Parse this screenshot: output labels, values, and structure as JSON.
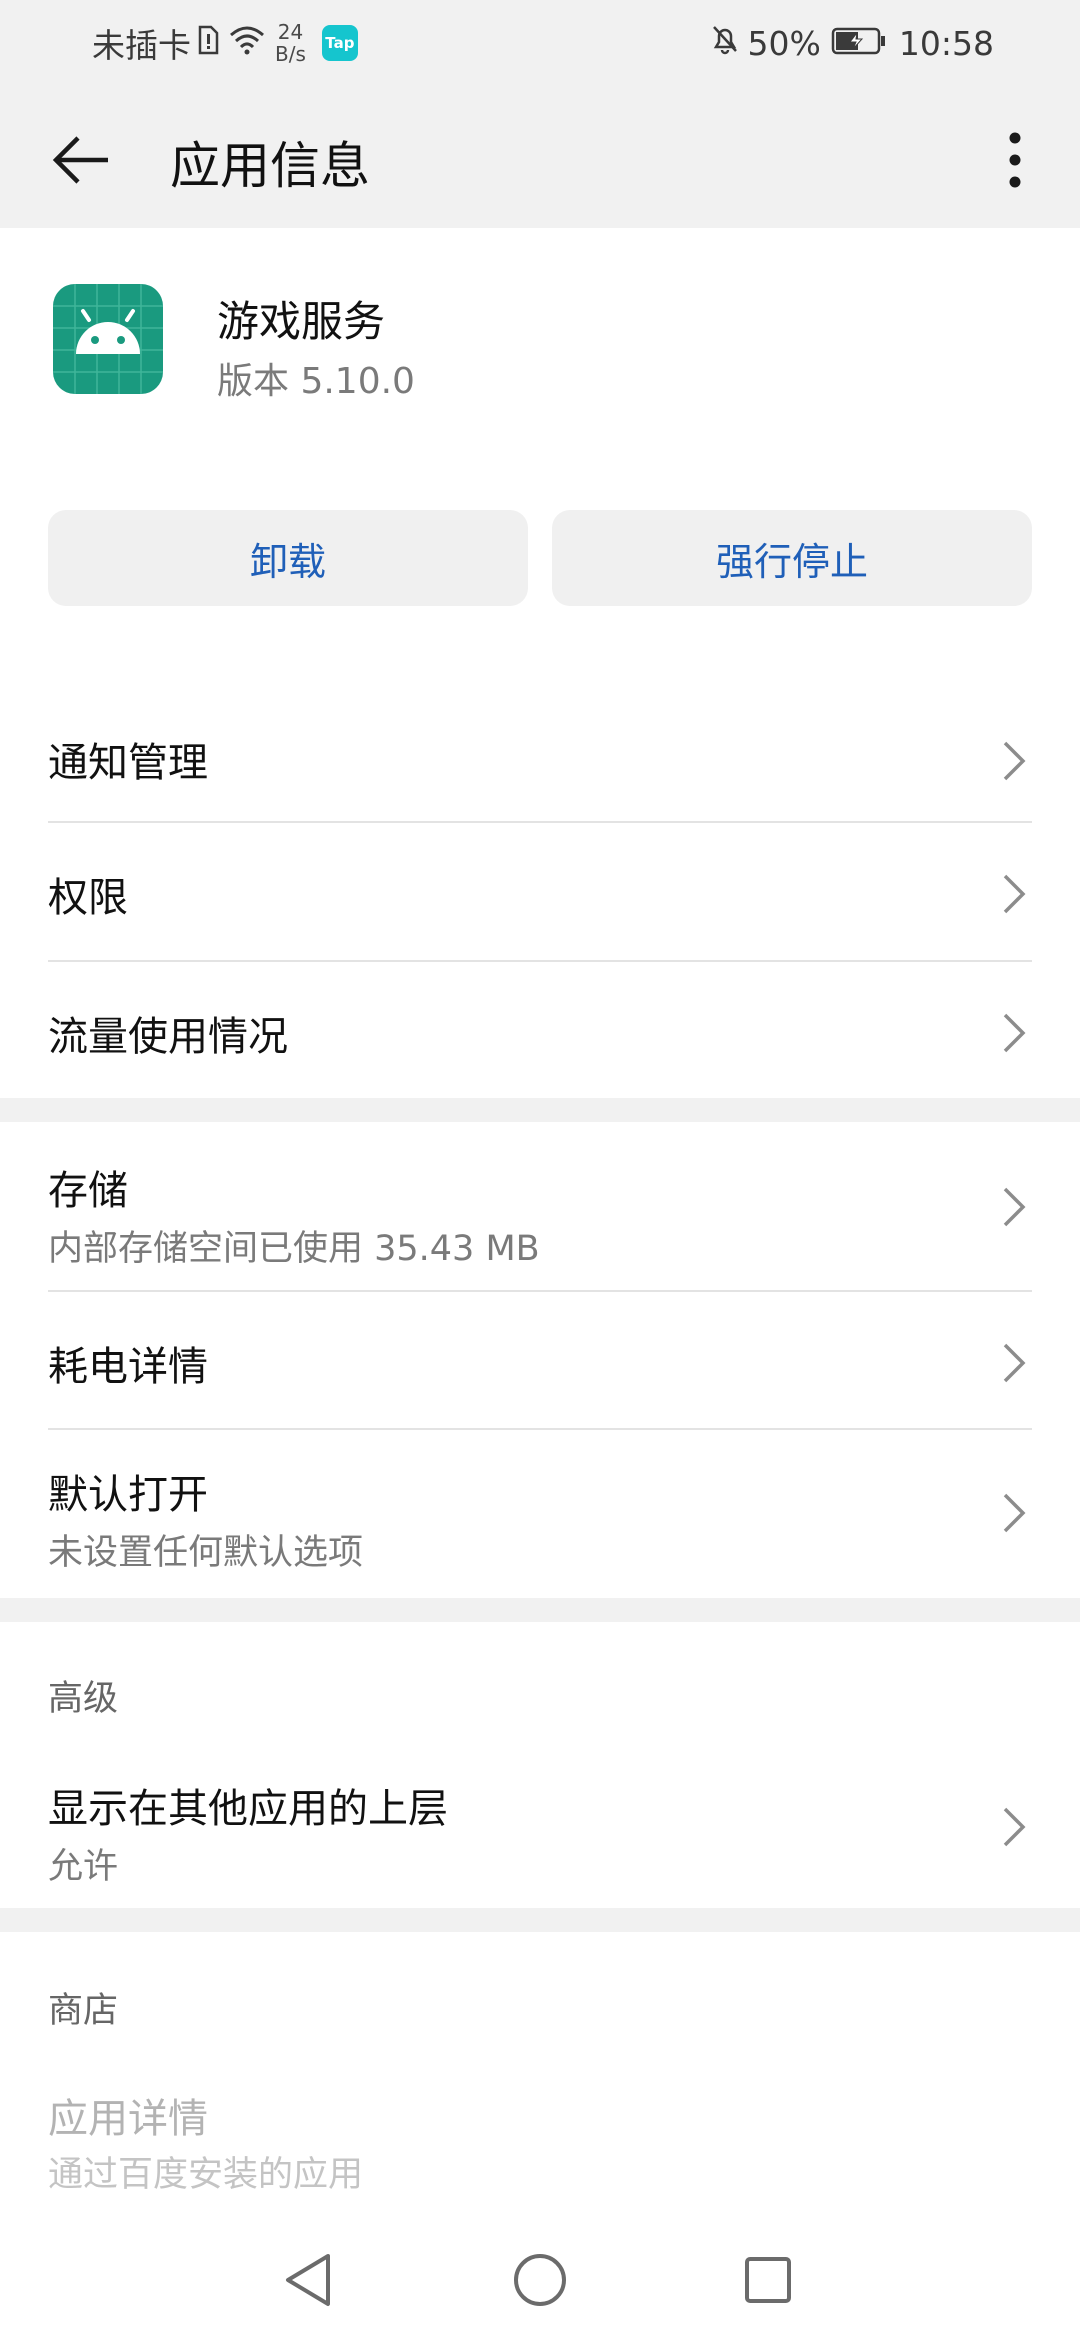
{
  "status_bar": {
    "carrier": "未插卡",
    "net_speed_value": "24",
    "net_speed_unit": "B/s",
    "tap_badge": "Tap",
    "battery_percent": "50%",
    "time": "10:58"
  },
  "app_bar": {
    "title": "应用信息"
  },
  "app": {
    "name": "游戏服务",
    "version": "版本 5.10.0",
    "icon_color": "#1a9a7f"
  },
  "actions": {
    "uninstall": "卸载",
    "force_stop": "强行停止",
    "accent": "#1f5fb8"
  },
  "rows": {
    "notifications": {
      "title": "通知管理"
    },
    "permissions": {
      "title": "权限"
    },
    "data_usage": {
      "title": "流量使用情况"
    },
    "storage": {
      "title": "存储",
      "subtitle": "内部存储空间已使用 35.43 MB"
    },
    "battery": {
      "title": "耗电详情"
    },
    "open_by_default": {
      "title": "默认打开",
      "subtitle": "未设置任何默认选项"
    },
    "overlay": {
      "title": "显示在其他应用的上层",
      "subtitle": "允许"
    },
    "app_details": {
      "title": "应用详情",
      "subtitle": "通过百度安装的应用"
    }
  },
  "sections": {
    "advanced": "高级",
    "store": "商店"
  }
}
